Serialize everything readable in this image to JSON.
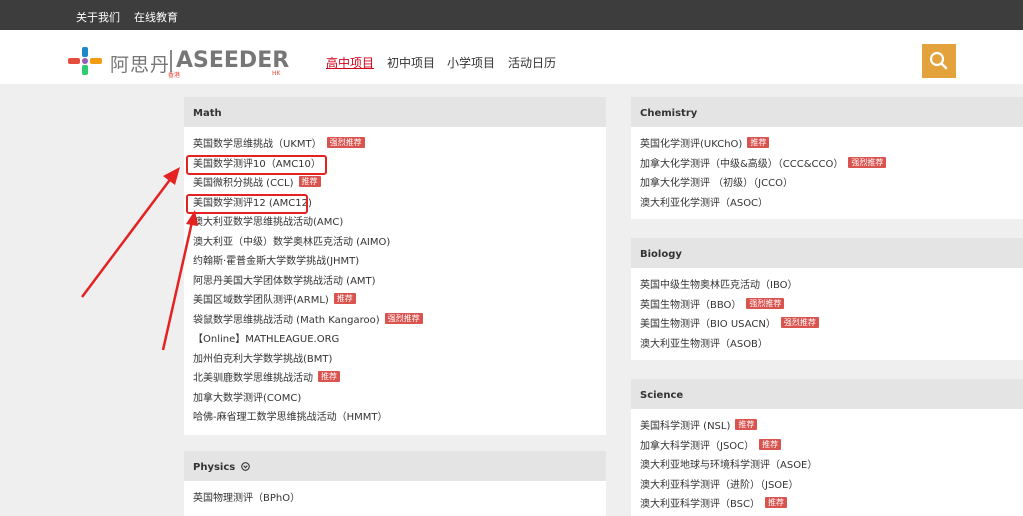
{
  "topbar": {
    "links": [
      "关于我们",
      "在线教育"
    ]
  },
  "logo": {
    "cn": "阿思丹",
    "cn_sub": "香港",
    "en": "ASEEDER",
    "en_sub": "HK"
  },
  "nav": {
    "items": [
      "高中项目",
      "初中项目",
      "小学项目",
      "活动日历"
    ],
    "active": "高中项目"
  },
  "search": {
    "icon": "search-icon"
  },
  "sections": {
    "math": {
      "title": "Math",
      "items": [
        {
          "label": "英国数学思维挑战（UKMT）",
          "tag": "强烈推荐"
        },
        {
          "label": "美国数学测评10（AMC10）",
          "tag": ""
        },
        {
          "label": "美国微积分挑战 (CCL)",
          "tag": "推荐"
        },
        {
          "label": "美国数学测评12 (AMC12)",
          "tag": ""
        },
        {
          "label": "澳大利亚数学思维挑战活动(AMC)",
          "tag": ""
        },
        {
          "label": "澳大利亚（中级）数学奥林匹克活动 (AIMO)",
          "tag": ""
        },
        {
          "label": "约翰斯·霍普金斯大学数学挑战(JHMT)",
          "tag": ""
        },
        {
          "label": "阿思丹美国大学团体数学挑战活动 (AMT)",
          "tag": ""
        },
        {
          "label": "美国区域数学团队测评(ARML)",
          "tag": "推荐"
        },
        {
          "label": "袋鼠数学思维挑战活动 (Math Kangaroo)",
          "tag": "强烈推荐"
        },
        {
          "label": "【Online】MATHLEAGUE.ORG",
          "tag": ""
        },
        {
          "label": "加州伯克利大学数学挑战(BMT)",
          "tag": ""
        },
        {
          "label": "北美驯鹿数学思维挑战活动",
          "tag": "推荐"
        },
        {
          "label": "加拿大数学测评(COMC)",
          "tag": ""
        },
        {
          "label": "哈佛-麻省理工数学思维挑战活动（HMMT）",
          "tag": ""
        }
      ]
    },
    "physics": {
      "title": "Physics",
      "title_icon": "circle-arrow-icon",
      "items": [
        {
          "label": "英国物理测评（BPhO）",
          "tag": ""
        }
      ]
    },
    "chemistry": {
      "title": "Chemistry",
      "items": [
        {
          "label": "英国化学测评(UKChO)",
          "tag": "推荐"
        },
        {
          "label": "加拿大化学测评（中级&高级）（CCC&CCO）",
          "tag": "强烈推荐"
        },
        {
          "label": "加拿大化学测评 （初级）（JCCO）",
          "tag": ""
        },
        {
          "label": "澳大利亚化学测评（ASOC）",
          "tag": ""
        }
      ]
    },
    "biology": {
      "title": "Biology",
      "items": [
        {
          "label": "英国中级生物奥林匹克活动（IBO）",
          "tag": ""
        },
        {
          "label": "英国生物测评（BBO）",
          "tag": "强烈推荐"
        },
        {
          "label": "美国生物测评（BIO USACN）",
          "tag": "强烈推荐"
        },
        {
          "label": "澳大利亚生物测评（ASOB）",
          "tag": ""
        }
      ]
    },
    "science": {
      "title": "Science",
      "items": [
        {
          "label": "美国科学测评 (NSL)",
          "tag": "推荐"
        },
        {
          "label": "加拿大科学测评（JSOC）",
          "tag": "推荐"
        },
        {
          "label": "澳大利亚地球与环境科学测评（ASOE）",
          "tag": ""
        },
        {
          "label": "澳大利亚科学测评（进阶）（JSOE）",
          "tag": ""
        },
        {
          "label": "澳大利亚科学测评（BSC）",
          "tag": "推荐"
        }
      ]
    }
  },
  "colors": {
    "accent": "#d0021b",
    "tag": "#d9534f",
    "search": "#e3a23c",
    "topbar": "#3d3d3d",
    "annotation": "#e52222"
  }
}
